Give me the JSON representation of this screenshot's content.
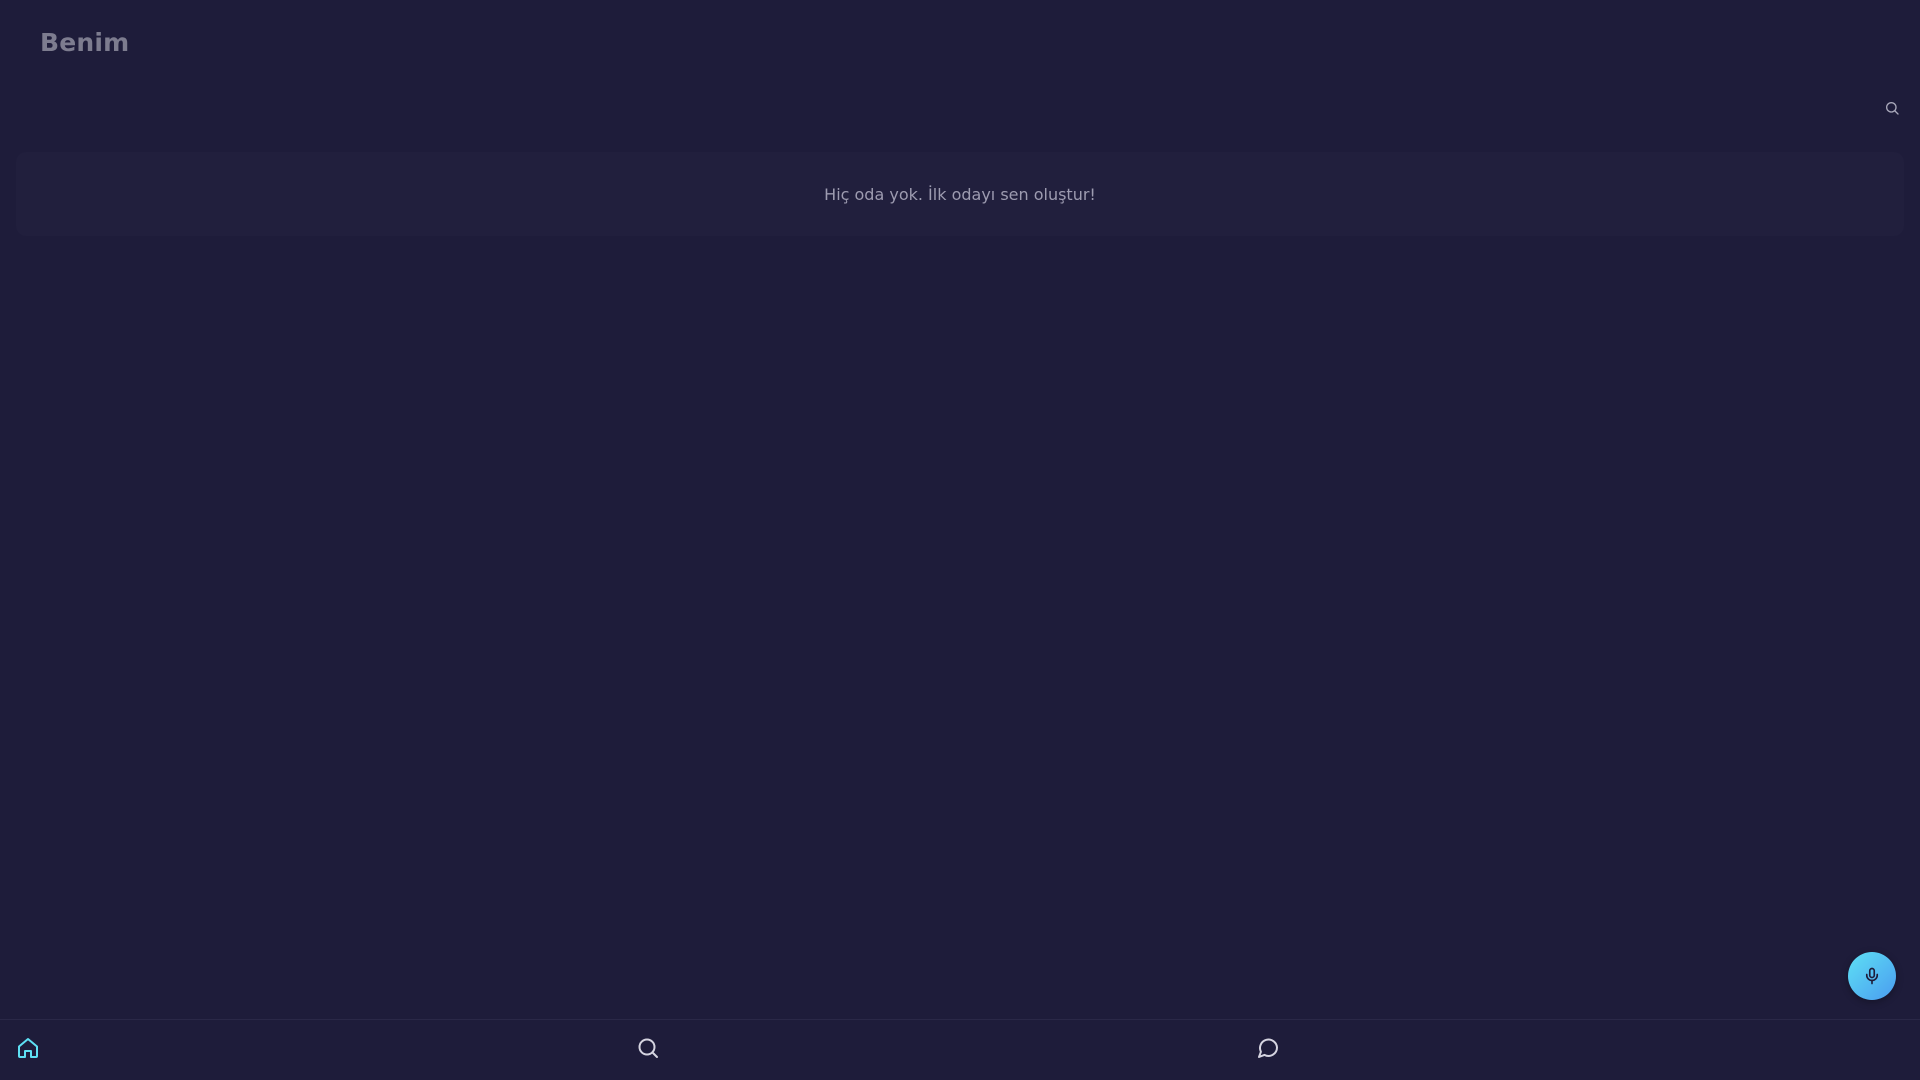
{
  "header": {
    "title": "Benim",
    "search_icon": "search-icon"
  },
  "rooms": {
    "empty_message": "Hiç oda yok. İlk odayı sen oluştur!"
  },
  "fab": {
    "icon": "microphone-icon"
  },
  "bottom_nav": {
    "items": [
      {
        "icon": "home-icon",
        "active": true
      },
      {
        "icon": "search-icon",
        "active": false
      },
      {
        "icon": "chat-icon",
        "active": false
      }
    ]
  },
  "colors": {
    "background": "#1e1c3a",
    "panel": "#211f3d",
    "accent": "#5ee0f4",
    "title": "#7d7c8f",
    "muted_text": "#9d9bb0"
  }
}
